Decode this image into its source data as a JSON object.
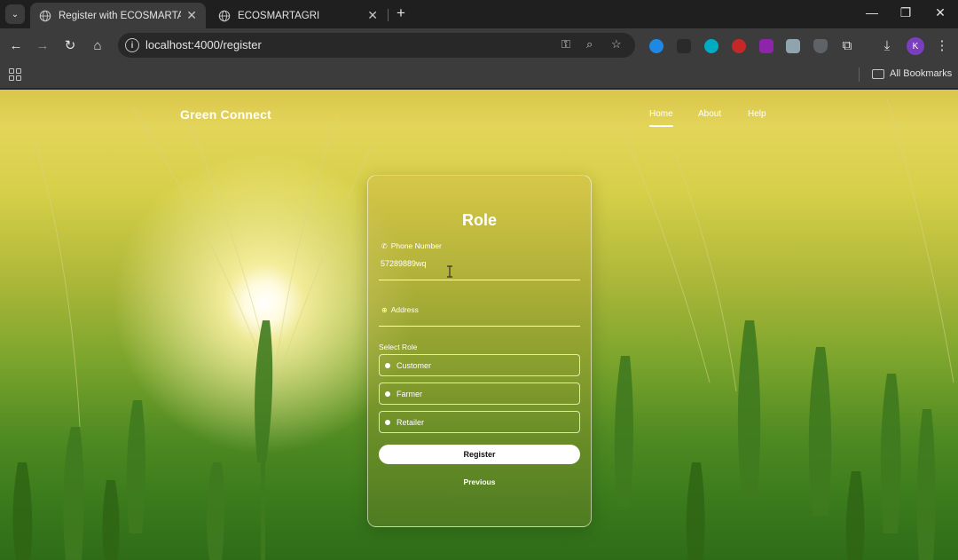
{
  "browser": {
    "tabs": [
      {
        "title": "Register with ECOSMARTAGRI",
        "active": true
      },
      {
        "title": "ECOSMARTAGRI",
        "active": false
      }
    ],
    "url": "localhost:4000/register",
    "bookmarks_label": "All Bookmarks",
    "profile_initial": "K"
  },
  "navbar": {
    "brand": "Green Connect",
    "links": [
      "Home",
      "About",
      "Help"
    ],
    "active_link": "Home"
  },
  "form": {
    "title": "Role",
    "phone": {
      "icon": "phone-icon",
      "label": "Phone Number",
      "value": "57289889wq"
    },
    "address": {
      "icon": "location-icon",
      "label": "Address",
      "value": ""
    },
    "select_role_label": "Select Role",
    "roles": [
      "Customer",
      "Farmer",
      "Retailer"
    ],
    "register_label": "Register",
    "previous_label": "Previous"
  },
  "colors": {
    "card_border": "#ffffff",
    "button_bg": "#ffffff",
    "chrome_bg": "#3c3c3c",
    "tabstrip_bg": "#1f1f1f",
    "profile_bg": "#7a3fbf"
  }
}
